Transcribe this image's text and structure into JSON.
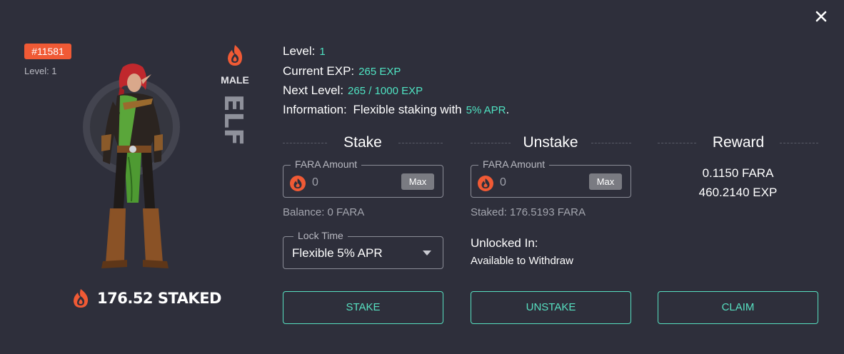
{
  "modal": {
    "close_label": "×"
  },
  "nft": {
    "id_badge": "#11581",
    "level_label": "Level: 1",
    "staked_total": "176.52 STAKED",
    "gender": "MALE",
    "race": "ELF"
  },
  "info": {
    "level_label": "Level:",
    "level_value": "1",
    "current_exp_label": "Current EXP:",
    "current_exp_value": "265 EXP",
    "next_level_label": "Next Level:",
    "next_level_value": "265 / 1000 EXP",
    "information_label": "Information:",
    "information_text": "Flexible staking with",
    "information_apr": "5% APR",
    "information_end": "."
  },
  "stake": {
    "title": "Stake",
    "amount_legend": "FARA Amount",
    "amount_value": "0",
    "max_label": "Max",
    "balance": "Balance: 0 FARA",
    "lock_legend": "Lock Time",
    "lock_value": "Flexible 5% APR",
    "button": "STAKE"
  },
  "unstake": {
    "title": "Unstake",
    "amount_legend": "FARA Amount",
    "amount_value": "0",
    "max_label": "Max",
    "staked": "Staked: 176.5193 FARA",
    "unlocked_label": "Unlocked In:",
    "unlocked_value": "Available to Withdraw",
    "button": "UNSTAKE"
  },
  "reward": {
    "title": "Reward",
    "fara": "0.1150 FARA",
    "exp": "460.2140 EXP",
    "button": "CLAIM"
  },
  "colors": {
    "accent": "#4fe3c2",
    "badge": "#f05a35",
    "background": "#2e2f3b",
    "flame": "#f05a35"
  },
  "icons": {
    "close": "close-icon",
    "token": "fara-flame-icon"
  }
}
